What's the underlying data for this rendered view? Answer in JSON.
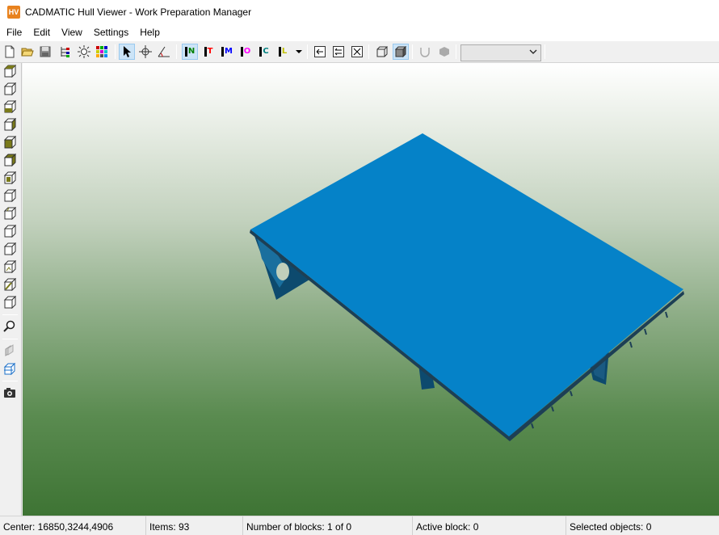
{
  "window": {
    "app_icon_text": "HV",
    "title": "CADMATIC Hull Viewer - Work Preparation Manager"
  },
  "menu": [
    "File",
    "Edit",
    "View",
    "Settings",
    "Help"
  ],
  "toolbar": {
    "letter_buttons": [
      {
        "letter": "N",
        "color": "#008000"
      },
      {
        "letter": "T",
        "color": "#ff0000"
      },
      {
        "letter": "M",
        "color": "#0000ff"
      },
      {
        "letter": "O",
        "color": "#ff00ff"
      },
      {
        "letter": "C",
        "color": "#008080"
      },
      {
        "letter": "L",
        "color": "#c0c000"
      }
    ],
    "combo_value": ""
  },
  "viewport": {
    "background_top": "#ffffff",
    "background_bottom": "#3e7434",
    "deck_color": "#0582c8",
    "structure_color": "#0d4a6e"
  },
  "statusbar": {
    "center": "Center: 16850,3244,4906",
    "items": "Items: 93",
    "blocks": "Number of blocks: 1 of 0",
    "active_block": "Active block: 0",
    "selected": "Selected objects: 0"
  }
}
